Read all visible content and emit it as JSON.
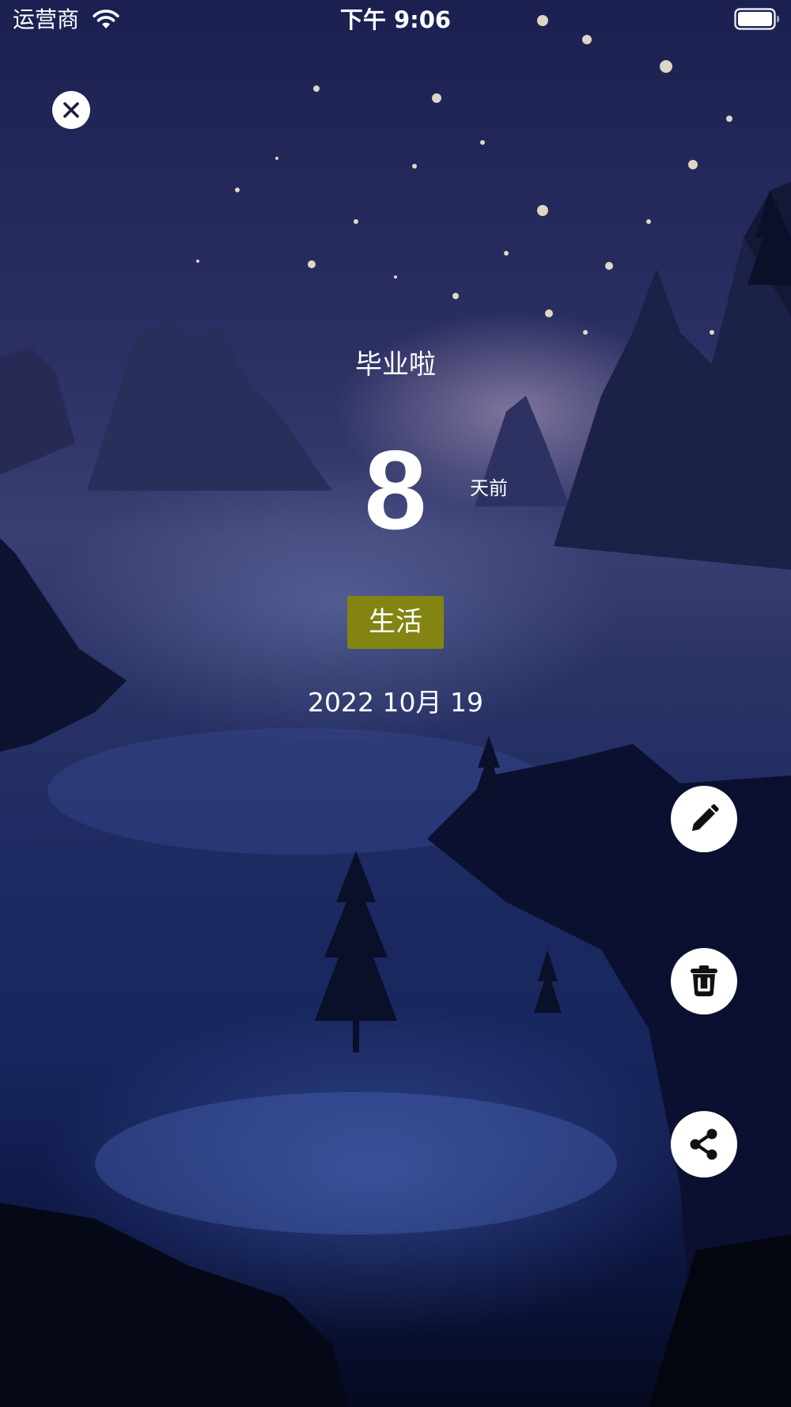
{
  "status_bar": {
    "carrier": "运营商",
    "time": "下午 9:06"
  },
  "event": {
    "title": "毕业啦",
    "days": "8",
    "unit": "天前",
    "category": "生活",
    "date": "2022 10月 19"
  },
  "colors": {
    "category_badge": "#838412",
    "fab_background": "#ffffff"
  },
  "icons": {
    "close": "close-icon",
    "edit": "pencil-icon",
    "delete": "trash-icon",
    "share": "share-icon"
  }
}
